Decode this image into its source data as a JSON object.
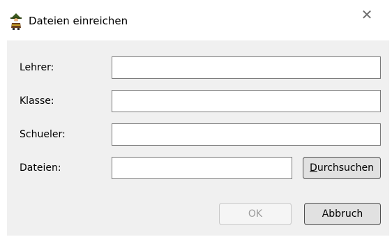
{
  "window": {
    "title": "Dateien einreichen",
    "app_icon": "gnome-figure-icon",
    "close_glyph": "✕"
  },
  "form": {
    "fields": [
      {
        "label": "Lehrer:",
        "value": ""
      },
      {
        "label": "Klasse:",
        "value": ""
      },
      {
        "label": "Schueler:",
        "value": ""
      },
      {
        "label": "Dateien:",
        "value": ""
      }
    ],
    "browse_button": {
      "mnemonic": "D",
      "rest": "urchsuchen"
    }
  },
  "buttons": {
    "ok_label": "OK",
    "ok_disabled": true,
    "cancel_label": "Abbruch"
  },
  "colors": {
    "client_background": "#f0f0f0",
    "input_border": "#7a7a7a",
    "button_face": "#e1e1e1"
  }
}
